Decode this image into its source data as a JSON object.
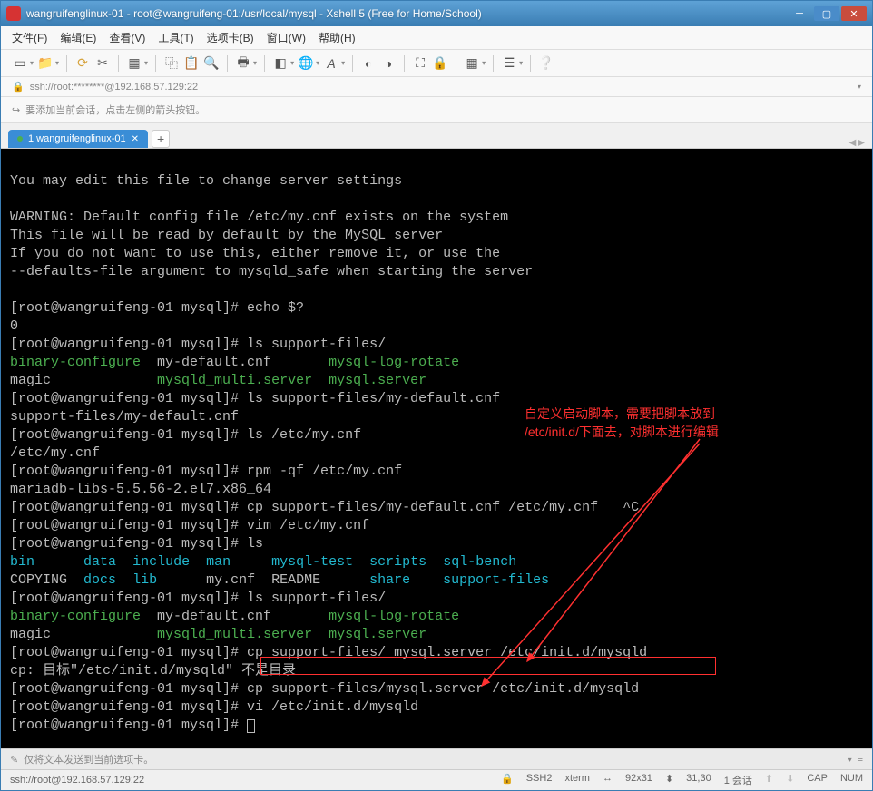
{
  "title": "wangruifenglinux-01 - root@wangruifeng-01:/usr/local/mysql - Xshell 5 (Free for Home/School)",
  "menu": {
    "file": "文件(F)",
    "edit": "编辑(E)",
    "view": "查看(V)",
    "tools": "工具(T)",
    "tabs": "选项卡(B)",
    "window": "窗口(W)",
    "help": "帮助(H)"
  },
  "address": "ssh://root:********@192.168.57.129:22",
  "info": "要添加当前会话，点击左侧的箭头按钮。",
  "tab": {
    "label": "1 wangruifenglinux-01"
  },
  "annotation": {
    "line1": "自定义启动脚本，需要把脚本放到",
    "line2": "/etc/init.d/下面去，对脚本进行编辑"
  },
  "statusline": "仅将文本发送到当前选项卡。",
  "status": {
    "conn": "ssh://root@192.168.57.129:22",
    "ssh": "SSH2",
    "term": "xterm",
    "size": "92x31",
    "pos": "31,30",
    "sessions": "1 会话",
    "cap": "CAP",
    "num": "NUM"
  },
  "term": {
    "l1": "You may edit this file to change server settings",
    "l2": "",
    "l3": "WARNING: Default config file /etc/my.cnf exists on the system",
    "l4": "This file will be read by default by the MySQL server",
    "l5": "If you do not want to use this, either remove it, or use the",
    "l6": "--defaults-file argument to mysqld_safe when starting the server",
    "l7": "",
    "p1": "[root@wangruifeng-01 mysql]# ",
    "c1": "echo $?",
    "r1": "0",
    "c2": "ls support-files/",
    "ls1a": "binary-configure",
    "ls1b": "  my-default.cnf       ",
    "ls1c": "mysql-log-rotate",
    "ls2a": "magic",
    "ls2b": "             ",
    "ls2c": "mysqld_multi.server",
    "ls2d": "  ",
    "ls2e": "mysql.server",
    "c3": "ls support-files/my-default.cnf",
    "r3": "support-files/my-default.cnf",
    "c4": "ls /etc/my.cnf",
    "r4": "/etc/my.cnf",
    "c5": "rpm -qf /etc/my.cnf",
    "r5": "mariadb-libs-5.5.56-2.el7.x86_64",
    "c6": "cp support-files/my-default.cnf /etc/my.cnf   ^C",
    "c7": "vim /etc/my.cnf",
    "c8": "ls",
    "ls3a": "bin",
    "ls3b": "      ",
    "ls3c": "data",
    "ls3d": "  ",
    "ls3e": "include",
    "ls3f": "  ",
    "ls3g": "man",
    "ls3h": "     ",
    "ls3i": "mysql-test",
    "ls3j": "  ",
    "ls3k": "scripts",
    "ls3l": "  ",
    "ls3m": "sql-bench",
    "ls4a": "COPYING",
    "ls4b": "  ",
    "ls4c": "docs",
    "ls4d": "  ",
    "ls4e": "lib",
    "ls4f": "      my.cnf  README      ",
    "ls4g": "share",
    "ls4h": "    ",
    "ls4i": "support-files",
    "c9": "ls support-files/",
    "c10": "cp support-files/ mysql.server /etc/init.d/mysqld",
    "r10": "cp: 目标\"/etc/init.d/mysqld\" 不是目录",
    "c11": "cp support-files/mysql.server /etc/init.d/mysqld",
    "c12": "vi /etc/init.d/mysqld"
  }
}
